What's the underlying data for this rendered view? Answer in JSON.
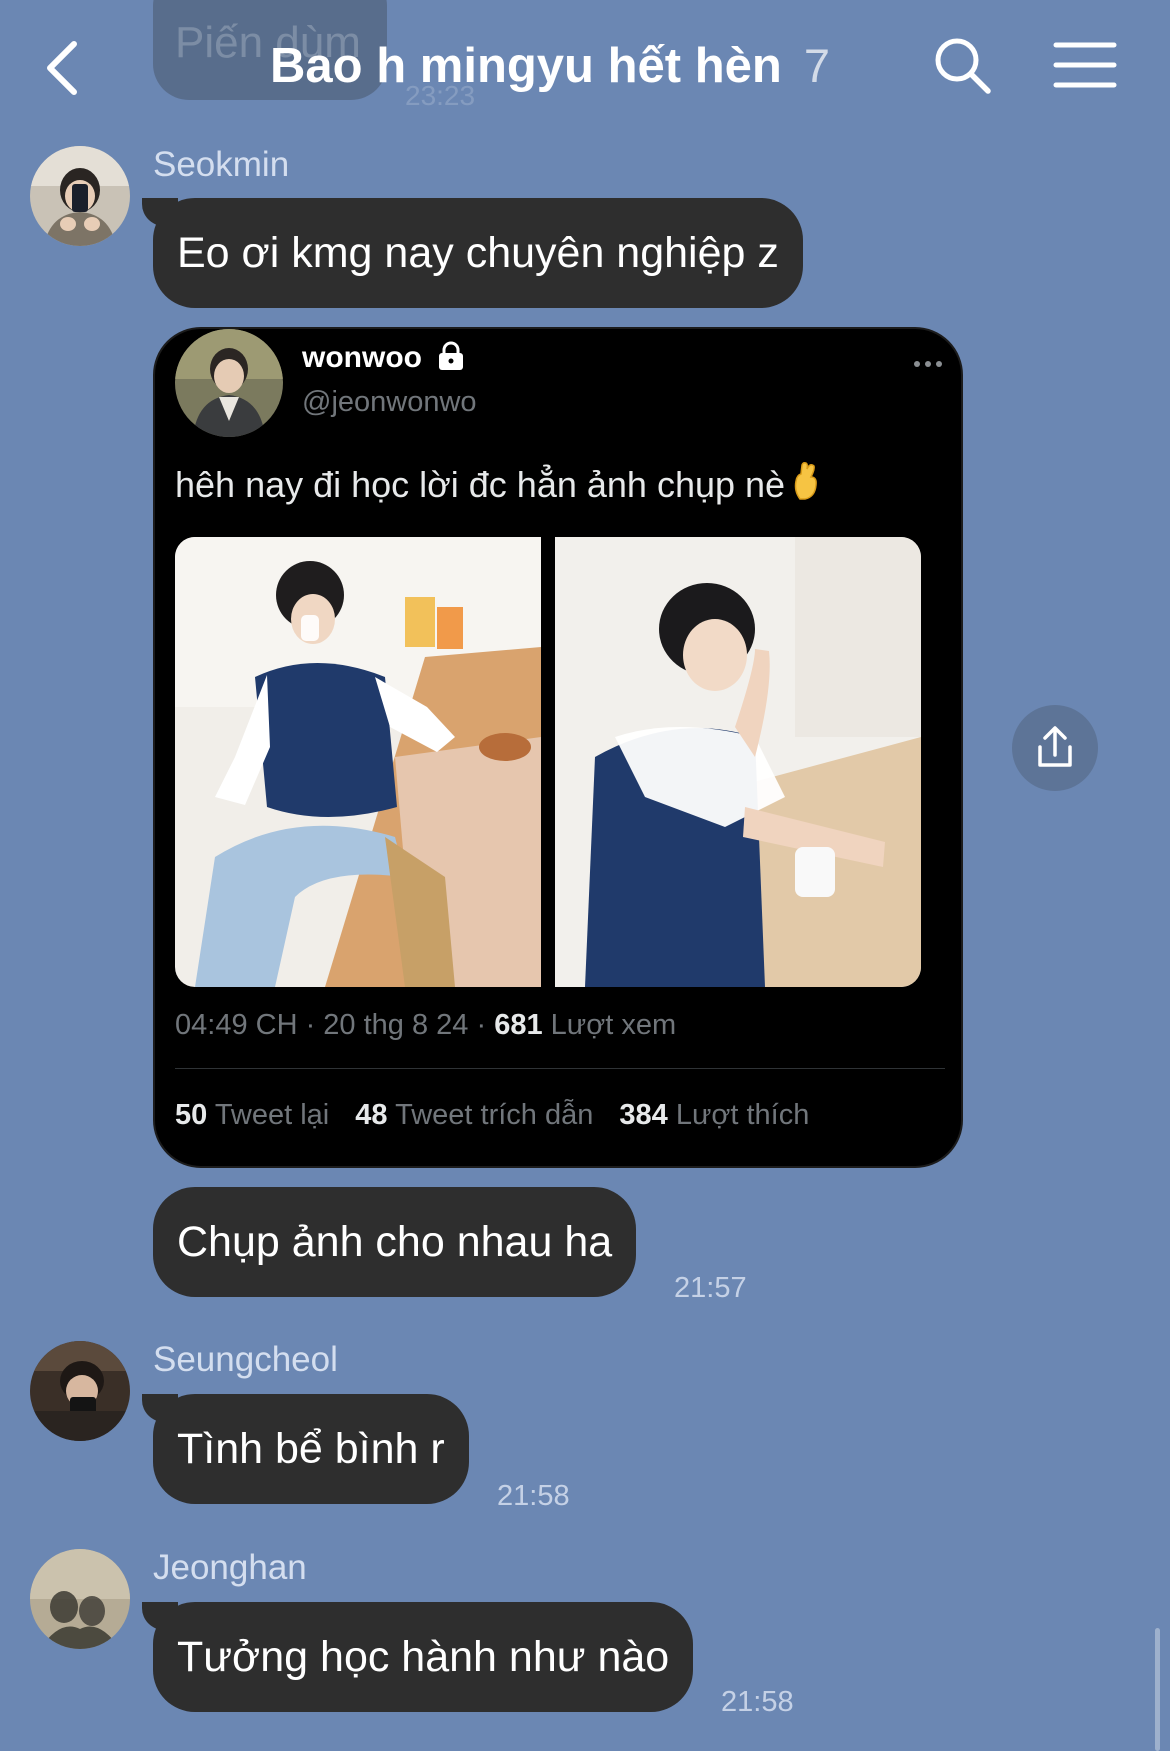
{
  "header": {
    "title": "Bao h mingyu hết hèn",
    "member_count": "7",
    "back_icon": "chevron-left-icon",
    "search_icon": "search-icon",
    "menu_icon": "hamburger-menu-icon"
  },
  "previous_message": {
    "text": "Piến dùm",
    "time": "23:23"
  },
  "messages": [
    {
      "sender": "Seokmin",
      "items": [
        {
          "kind": "text",
          "text": "Eo ơi kmg nay chuyên nghiệp z"
        },
        {
          "kind": "tweet"
        },
        {
          "kind": "text",
          "text": "Chụp ảnh cho nhau ha",
          "time": "21:57"
        }
      ]
    },
    {
      "sender": "Seungcheol",
      "items": [
        {
          "kind": "text",
          "text": "Tình bể bình r",
          "time": "21:58"
        }
      ]
    },
    {
      "sender": "Jeonghan",
      "items": [
        {
          "kind": "text",
          "text": "Tưởng học hành như nào",
          "time": "21:58"
        }
      ]
    }
  ],
  "tweet": {
    "display_name": "wonwoo",
    "handle": "@jeonwonwo",
    "text": "hêh nay đi học lời đc hẳn ảnh chụp nè",
    "emoji": "🤞",
    "meta_time": "04:49 CH",
    "meta_date": "20 thg 8 24",
    "views_count": "681",
    "views_label": "Lượt xem",
    "retweets_count": "50",
    "retweets_label": "Tweet lại",
    "quotes_count": "48",
    "quotes_label": "Tweet trích dẫn",
    "likes_count": "384",
    "likes_label": "Lượt thích"
  },
  "share_icon": "share-icon",
  "colors": {
    "chat_background": "#6b87b3",
    "bubble": "#2e2e2e",
    "bubble_text": "#ffffff",
    "tweet_background": "#000000",
    "tweet_secondary_text": "#71767b"
  }
}
